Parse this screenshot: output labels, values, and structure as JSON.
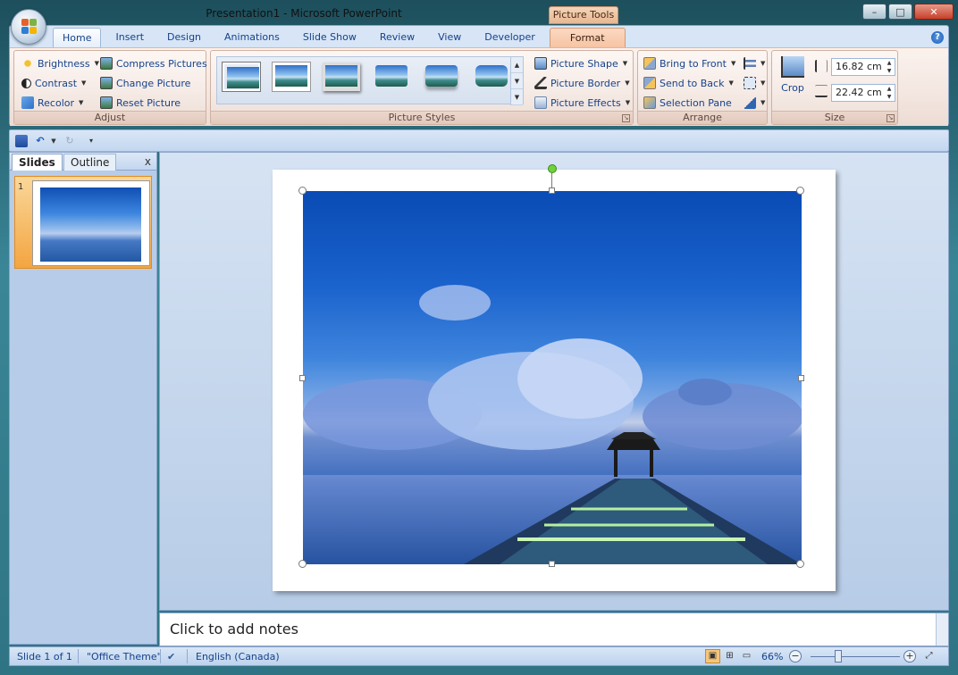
{
  "window": {
    "title": "Presentation1 - Microsoft PowerPoint",
    "context_tab": "Picture Tools",
    "minimize": "–",
    "maximize": "□",
    "close": "✕"
  },
  "ribbon": {
    "tabs": [
      "Home",
      "Insert",
      "Design",
      "Animations",
      "Slide Show",
      "Review",
      "View",
      "Developer",
      "Format"
    ],
    "active_tab": "Format",
    "help": "?",
    "groups": {
      "adjust": {
        "label": "Adjust",
        "items": [
          "Brightness",
          "Contrast",
          "Recolor",
          "Compress Pictures",
          "Change Picture",
          "Reset Picture"
        ]
      },
      "picture_styles": {
        "label": "Picture Styles",
        "items": [
          "Picture Shape",
          "Picture Border",
          "Picture Effects"
        ]
      },
      "arrange": {
        "label": "Arrange",
        "items": [
          "Bring to Front",
          "Send to Back",
          "Selection Pane"
        ]
      },
      "size": {
        "label": "Size",
        "crop": "Crop",
        "height": "16.82 cm",
        "width": "22.42 cm"
      }
    }
  },
  "left_pane": {
    "tabs": [
      "Slides",
      "Outline"
    ],
    "close": "x",
    "slide_number": "1"
  },
  "notes": {
    "placeholder": "Click to add notes"
  },
  "status_bar": {
    "slide": "Slide 1 of 1",
    "theme": "\"Office Theme\"",
    "language": "English (Canada)",
    "zoom": "66%",
    "zoom_level": 0.66
  },
  "colors": {
    "ribbon_accent": "#d7e5f6",
    "format_tab": "#f6c4a3",
    "selection_handle": "#6fd23a"
  }
}
